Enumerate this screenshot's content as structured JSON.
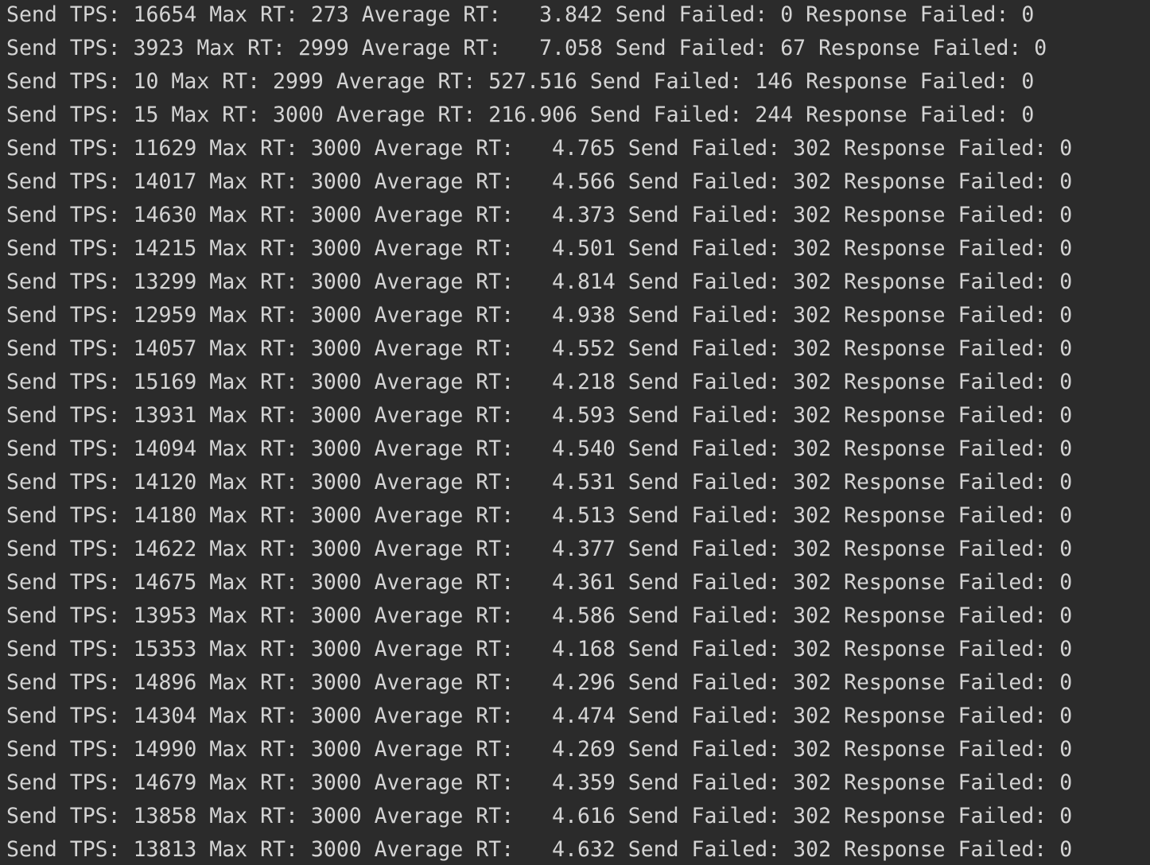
{
  "console": {
    "lines": [
      "Send TPS: 16654 Max RT: 273 Average RT:   3.842 Send Failed: 0 Response Failed: 0",
      "Send TPS: 3923 Max RT: 2999 Average RT:   7.058 Send Failed: 67 Response Failed: 0",
      "Send TPS: 10 Max RT: 2999 Average RT: 527.516 Send Failed: 146 Response Failed: 0",
      "Send TPS: 15 Max RT: 3000 Average RT: 216.906 Send Failed: 244 Response Failed: 0",
      "Send TPS: 11629 Max RT: 3000 Average RT:   4.765 Send Failed: 302 Response Failed: 0",
      "Send TPS: 14017 Max RT: 3000 Average RT:   4.566 Send Failed: 302 Response Failed: 0",
      "Send TPS: 14630 Max RT: 3000 Average RT:   4.373 Send Failed: 302 Response Failed: 0",
      "Send TPS: 14215 Max RT: 3000 Average RT:   4.501 Send Failed: 302 Response Failed: 0",
      "Send TPS: 13299 Max RT: 3000 Average RT:   4.814 Send Failed: 302 Response Failed: 0",
      "Send TPS: 12959 Max RT: 3000 Average RT:   4.938 Send Failed: 302 Response Failed: 0",
      "Send TPS: 14057 Max RT: 3000 Average RT:   4.552 Send Failed: 302 Response Failed: 0",
      "Send TPS: 15169 Max RT: 3000 Average RT:   4.218 Send Failed: 302 Response Failed: 0",
      "Send TPS: 13931 Max RT: 3000 Average RT:   4.593 Send Failed: 302 Response Failed: 0",
      "Send TPS: 14094 Max RT: 3000 Average RT:   4.540 Send Failed: 302 Response Failed: 0",
      "Send TPS: 14120 Max RT: 3000 Average RT:   4.531 Send Failed: 302 Response Failed: 0",
      "Send TPS: 14180 Max RT: 3000 Average RT:   4.513 Send Failed: 302 Response Failed: 0",
      "Send TPS: 14622 Max RT: 3000 Average RT:   4.377 Send Failed: 302 Response Failed: 0",
      "Send TPS: 14675 Max RT: 3000 Average RT:   4.361 Send Failed: 302 Response Failed: 0",
      "Send TPS: 13953 Max RT: 3000 Average RT:   4.586 Send Failed: 302 Response Failed: 0",
      "Send TPS: 15353 Max RT: 3000 Average RT:   4.168 Send Failed: 302 Response Failed: 0",
      "Send TPS: 14896 Max RT: 3000 Average RT:   4.296 Send Failed: 302 Response Failed: 0",
      "Send TPS: 14304 Max RT: 3000 Average RT:   4.474 Send Failed: 302 Response Failed: 0",
      "Send TPS: 14990 Max RT: 3000 Average RT:   4.269 Send Failed: 302 Response Failed: 0",
      "Send TPS: 14679 Max RT: 3000 Average RT:   4.359 Send Failed: 302 Response Failed: 0",
      "Send TPS: 13858 Max RT: 3000 Average RT:   4.616 Send Failed: 302 Response Failed: 0",
      "Send TPS: 13813 Max RT: 3000 Average RT:   4.632 Send Failed: 302 Response Failed: 0"
    ]
  },
  "colors": {
    "background": "#2b2b2b",
    "text": "#d4d4d4"
  }
}
